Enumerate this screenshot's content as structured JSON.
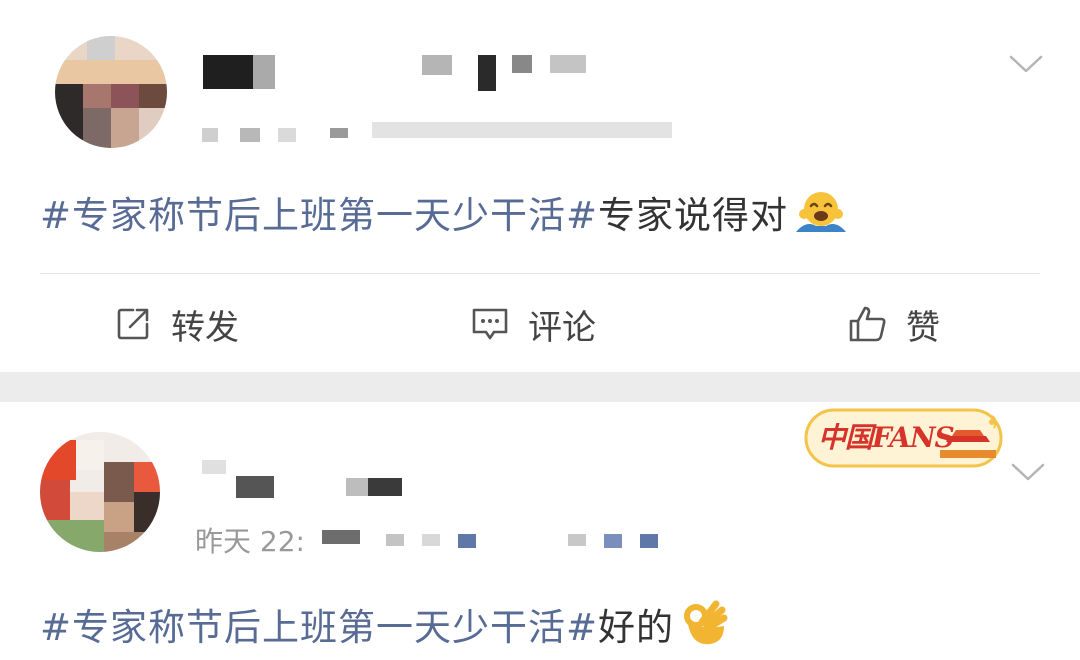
{
  "colors": {
    "hashtag": "#576b95",
    "text": "#333333",
    "separator": "#ececec",
    "divider": "#e6e6e6",
    "icon": "#555555",
    "badge_red": "#d6332a",
    "badge_gold": "#f3c34a"
  },
  "posts": [
    {
      "avatar_icon": "user-avatar-blurred",
      "author_name": "",
      "meta_text": "",
      "menu_icon": "chevron-down-icon",
      "content": {
        "hashtag": "#专家称节后上班第一天少干活#",
        "text": "专家说得对",
        "emoji": "hugging-face-emoji"
      },
      "actions": [
        {
          "label": "转发",
          "icon": "share-icon"
        },
        {
          "label": "评论",
          "icon": "comment-icon"
        },
        {
          "label": "赞",
          "icon": "thumbs-up-icon"
        }
      ]
    },
    {
      "avatar_icon": "user-avatar-blurred",
      "author_name": "",
      "meta_text": "昨天 22:",
      "menu_icon": "chevron-down-icon",
      "badge": {
        "text": "中国FANS",
        "icon": "tiananmen-badge-icon"
      },
      "content": {
        "hashtag": "#专家称节后上班第一天少干活#",
        "text": "好的",
        "emoji": "ok-hand-emoji"
      }
    }
  ]
}
